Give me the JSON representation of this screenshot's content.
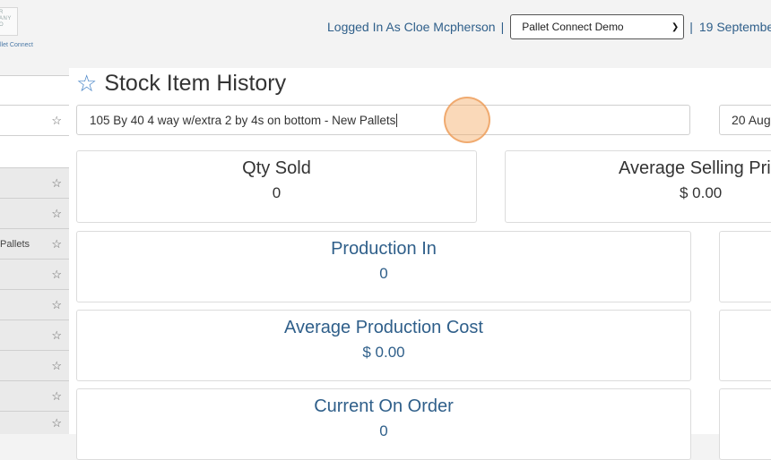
{
  "header": {
    "logo_text": "R\nANY\nO",
    "logo_caption": "llet Connect",
    "logged_in": "Logged In As Cloe Mcpherson",
    "separator": "|",
    "company_select": "Pallet Connect Demo",
    "date": "19 Septembe"
  },
  "sidebar": {
    "items": [
      {
        "label": ""
      },
      {
        "label": ""
      },
      {
        "label": ""
      },
      {
        "label": ""
      },
      {
        "label": ""
      },
      {
        "label": "Pallets"
      },
      {
        "label": ""
      },
      {
        "label": ""
      },
      {
        "label": ""
      },
      {
        "label": ""
      },
      {
        "label": ""
      },
      {
        "label": ""
      }
    ]
  },
  "main": {
    "title": "Stock Item History",
    "item_input_value": "105 By 40 4 way w/extra 2 by 4s on bottom - New Pallets",
    "date_input_value": "20 Aug",
    "cards": {
      "qty_sold": {
        "label": "Qty Sold",
        "value": "0"
      },
      "avg_selling_price": {
        "label": "Average Selling Pri",
        "value": "$ 0.00"
      },
      "production_in": {
        "label": "Production In",
        "value": "0"
      },
      "avg_production_cost": {
        "label": "Average Production Cost",
        "value": "$ 0.00"
      },
      "current_on_order": {
        "label": "Current On Order",
        "value": "0"
      }
    }
  },
  "icons": {
    "star": "star-outline-icon",
    "favorite": "star-outline-icon"
  },
  "colors": {
    "accent_blue": "#2f5f8a",
    "favorite_star": "#4a86c8",
    "click_indicator": "#f5aa64"
  }
}
